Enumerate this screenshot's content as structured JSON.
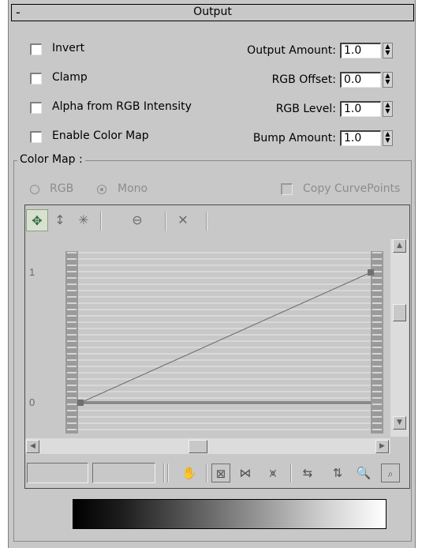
{
  "rollout": {
    "title": "Output",
    "collapse_symbol": "-"
  },
  "options": {
    "invert": {
      "label": "Invert",
      "checked": false
    },
    "clamp": {
      "label": "Clamp",
      "checked": false
    },
    "alpha": {
      "label": "Alpha from RGB Intensity",
      "checked": false
    },
    "enable_color_map": {
      "label": "Enable Color Map",
      "checked": false
    }
  },
  "params": {
    "output_amount": {
      "label": "Output Amount:",
      "value": "1.0"
    },
    "rgb_offset": {
      "label": "RGB Offset:",
      "value": "0.0"
    },
    "rgb_level": {
      "label": "RGB Level:",
      "value": "1.0"
    },
    "bump_amount": {
      "label": "Bump Amount:",
      "value": "1.0"
    }
  },
  "color_map": {
    "title": "Color Map :",
    "rgb_label": "RGB",
    "mono_label": "Mono",
    "selected_mode": "Mono",
    "copy_curve_points": {
      "label": "Copy CurvePoints",
      "checked": false,
      "enabled": false
    }
  },
  "toolbar": {
    "icons": [
      "move-icon",
      "scale-point-icon",
      "insert-point-icon",
      "reset-curve-icon",
      "delete-point-icon"
    ]
  },
  "graph": {
    "y_tick_top": "1",
    "y_tick_bottom": "0",
    "curve_points": [
      {
        "x": 0.0,
        "y": 0.0
      },
      {
        "x": 1.0,
        "y": 1.0
      }
    ]
  },
  "bottom_fields": {
    "x_value": "",
    "y_value": ""
  },
  "bottom_tools": {
    "icons": [
      "pan-hand-icon",
      "zoom-extents-icon",
      "zoom-horizontal-extents-icon",
      "zoom-value-extents-icon",
      "zoom-horizontal-icon",
      "zoom-vertical-icon",
      "zoom-icon",
      "zoom-region-icon"
    ]
  },
  "colors": {
    "panel_bg": "#c8c8c8",
    "curve_line": "#6a6a6a",
    "grid_line": "#e8e8e8",
    "toolbar_active": "#2e6e40"
  }
}
